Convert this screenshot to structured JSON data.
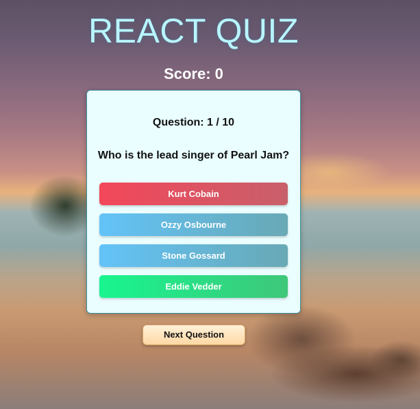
{
  "app": {
    "title": "REACT QUIZ"
  },
  "score": {
    "label": "Score: 0"
  },
  "question": {
    "count_label": "Question: 1 / 10",
    "text": "Who is the lead singer of Pearl Jam?"
  },
  "answers": [
    {
      "label": "Kurt Cobain",
      "state": "wrong"
    },
    {
      "label": "Ozzy Osbourne",
      "state": "neutral"
    },
    {
      "label": "Stone Gossard",
      "state": "neutral"
    },
    {
      "label": "Eddie Vedder",
      "state": "correct"
    }
  ],
  "controls": {
    "next_label": "Next Question"
  },
  "colors": {
    "title": "#b8f5ff",
    "card_bg": "#eafdff",
    "wrong": "#f3475a",
    "neutral": "#63c3f8",
    "correct": "#18f58f",
    "next_button": "#ffd8a4"
  }
}
